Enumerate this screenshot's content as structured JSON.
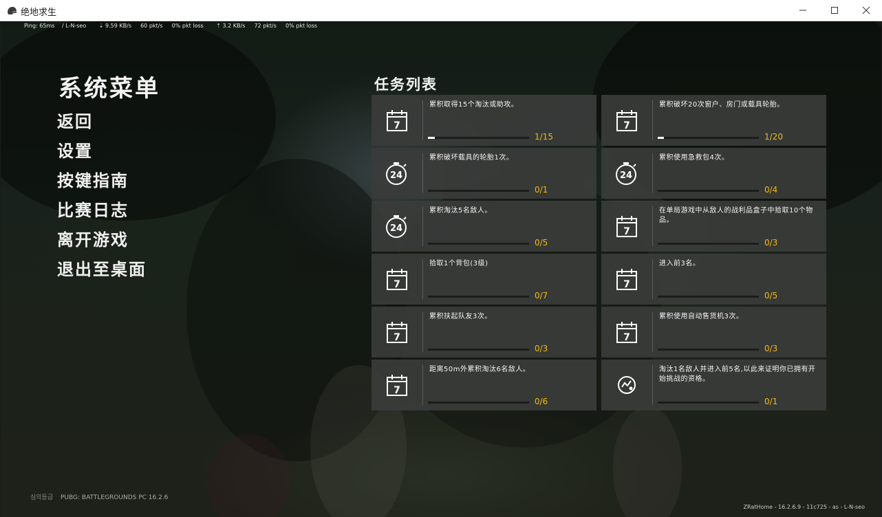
{
  "window": {
    "title": "绝地求生",
    "icon": "helmet-icon",
    "controls": [
      "minimize-icon",
      "maximize-icon",
      "close-icon"
    ]
  },
  "netstats": {
    "ping": "Ping: 65ms",
    "region": "/ L-N-seo",
    "down_rate": "9.59 KB/s",
    "down_pkts": "60 pkt/s",
    "down_loss": "0% pkt loss",
    "up_rate": "3.2 KB/s",
    "up_pkts": "72 pkt/s",
    "up_loss": "0% pkt loss"
  },
  "menu": {
    "title": "系统菜单",
    "items": [
      "返回",
      "设置",
      "按键指南",
      "比赛日志",
      "离开游戏",
      "退出至桌面"
    ]
  },
  "missions": {
    "title": "任务列表",
    "accent_color": "#f2b90f",
    "items": [
      {
        "icon": "calendar-7-icon",
        "desc": "累积取得15个淘汰或助攻。",
        "progress": "1/15",
        "fraction": 0.0667
      },
      {
        "icon": "calendar-7-icon",
        "desc": "累积破坏20次窗户、房门或载具轮胎。",
        "progress": "1/20",
        "fraction": 0.05
      },
      {
        "icon": "stopwatch-24-icon",
        "desc": "累积破坏载具的轮胎1次。",
        "progress": "0/1",
        "fraction": 0
      },
      {
        "icon": "stopwatch-24-icon",
        "desc": "累积使用急救包4次。",
        "progress": "0/4",
        "fraction": 0
      },
      {
        "icon": "stopwatch-24-icon",
        "desc": "累积淘汰5名敌人。",
        "progress": "0/5",
        "fraction": 0
      },
      {
        "icon": "calendar-7-icon",
        "desc": "在单局游戏中从敌人的战利品盒子中拾取10个物品。",
        "progress": "0/3",
        "fraction": 0
      },
      {
        "icon": "calendar-7-icon",
        "desc": "拾取1个背包(3级)",
        "progress": "0/7",
        "fraction": 0
      },
      {
        "icon": "calendar-7-icon",
        "desc": "进入前3名。",
        "progress": "0/5",
        "fraction": 0
      },
      {
        "icon": "calendar-7-icon",
        "desc": "累积扶起队友3次。",
        "progress": "0/3",
        "fraction": 0
      },
      {
        "icon": "calendar-7-icon",
        "desc": "累积使用自动售货机3次。",
        "progress": "0/3",
        "fraction": 0
      },
      {
        "icon": "calendar-7-icon",
        "desc": "距离50m外累积淘汰6名敌人。",
        "progress": "0/6",
        "fraction": 0
      },
      {
        "icon": "challenge-badge-icon",
        "desc": "淘汰1名敌人并进入前5名,以此来证明你已拥有开始挑战的资格。",
        "progress": "0/1",
        "fraction": 0
      }
    ]
  },
  "footer": {
    "rating": "심의등급",
    "version": "PUBG: BATTLEGROUNDS PC  16.2.6",
    "build": "ZRatHome - 16.2.6.9 - 11c725 - as - L-N-seo"
  }
}
